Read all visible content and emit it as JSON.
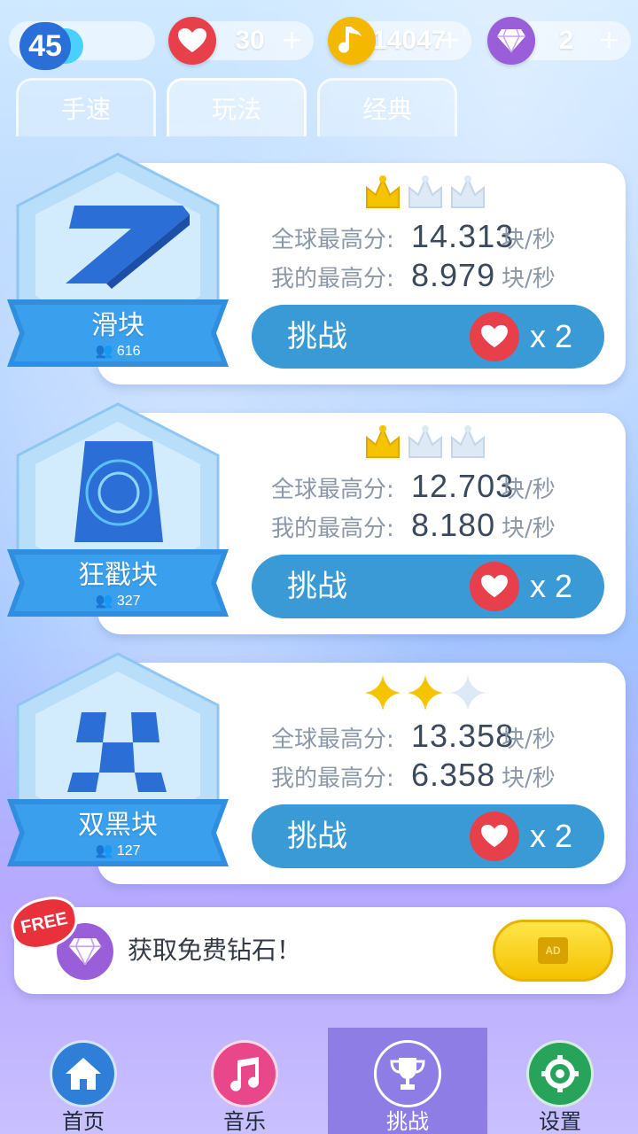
{
  "topbar": {
    "level": "45",
    "lives": "30",
    "notes": "14047",
    "diamonds": "2",
    "plus": "+"
  },
  "tabs": [
    {
      "label": "手速",
      "active": false
    },
    {
      "label": "玩法",
      "active": true
    },
    {
      "label": "经典",
      "active": false
    }
  ],
  "modes": [
    {
      "name": "滑块",
      "players": "616",
      "rating_icon": "crown",
      "rating": 1,
      "rating_max": 3,
      "global_label": "全球最高分:",
      "global_value": "14.313",
      "my_label": "我的最高分:",
      "my_value": "8.979",
      "unit": "块/秒",
      "button_label": "挑战",
      "cost": "x 2"
    },
    {
      "name": "狂戳块",
      "players": "327",
      "rating_icon": "crown",
      "rating": 1,
      "rating_max": 3,
      "global_label": "全球最高分:",
      "global_value": "12.703",
      "my_label": "我的最高分:",
      "my_value": "8.180",
      "unit": "块/秒",
      "button_label": "挑战",
      "cost": "x 2"
    },
    {
      "name": "双黑块",
      "players": "127",
      "rating_icon": "star",
      "rating": 2,
      "rating_max": 3,
      "global_label": "全球最高分:",
      "global_value": "13.358",
      "my_label": "我的最高分:",
      "my_value": "6.358",
      "unit": "块/秒",
      "button_label": "挑战",
      "cost": "x 2"
    }
  ],
  "ad": {
    "free_tag": "FREE",
    "text": "获取免费钻石！",
    "button_tag": "AD"
  },
  "nav": [
    {
      "label": "首页",
      "icon": "home-icon",
      "color": "#2f7fd8"
    },
    {
      "label": "音乐",
      "icon": "music-icon",
      "color": "#e8478a"
    },
    {
      "label": "挑战",
      "icon": "trophy-icon",
      "color": "#8f7de6"
    },
    {
      "label": "设置",
      "icon": "gear-icon",
      "color": "#27a35a"
    }
  ],
  "colors": {
    "heart": "#e8404a",
    "note": "#f5b800",
    "diamond": "#9a5fd8",
    "button": "#3a9ad6",
    "crown_gold": "#f5c400",
    "crown_empty": "#dde9f5"
  }
}
